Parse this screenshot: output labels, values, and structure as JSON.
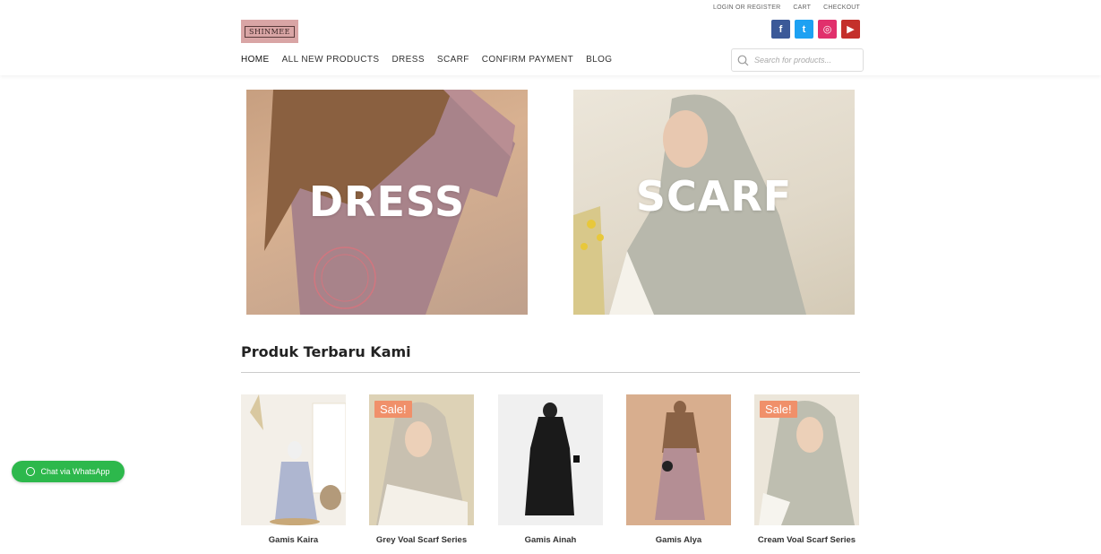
{
  "header": {
    "top_links": [
      "LOGIN OR REGISTER",
      "CART",
      "CHECKOUT"
    ],
    "logo_text": "SHINMEE",
    "socials": [
      {
        "name": "facebook",
        "glyph": "f"
      },
      {
        "name": "twitter",
        "glyph": "t"
      },
      {
        "name": "instagram",
        "glyph": "◎"
      },
      {
        "name": "youtube",
        "glyph": "▶"
      }
    ],
    "nav": [
      "HOME",
      "ALL NEW PRODUCTS",
      "DRESS",
      "SCARF",
      "CONFIRM PAYMENT",
      "BLOG"
    ],
    "search_placeholder": "Search for products..."
  },
  "banners": [
    {
      "label": "DRESS"
    },
    {
      "label": "SCARF"
    }
  ],
  "section": {
    "title": "Produk Terbaru Kami"
  },
  "products": [
    {
      "name": "Gamis Kaira",
      "sale": ""
    },
    {
      "name": "Grey Voal Scarf Series",
      "sale": "Sale!"
    },
    {
      "name": "Gamis Ainah",
      "sale": ""
    },
    {
      "name": "Gamis Alya",
      "sale": ""
    },
    {
      "name": "Cream Voal Scarf Series",
      "sale": "Sale!"
    }
  ],
  "whatsapp": {
    "label": "Chat via WhatsApp"
  },
  "colors": {
    "sale_badge": "#f0906a",
    "whatsapp": "#2db84c",
    "logo_bg": "#d9a5a5"
  }
}
